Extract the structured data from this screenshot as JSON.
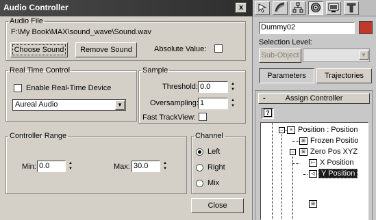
{
  "window": {
    "title": "Audio Controller",
    "close_glyph": "x"
  },
  "audio_file": {
    "legend": "Audio File",
    "path": "F:\\My Book\\MAX\\sound_wave\\Sound.wav",
    "choose_label": "Choose Sound",
    "remove_label": "Remove Sound",
    "absolute_label": "Absolute Value:"
  },
  "realtime": {
    "legend": "Real Time Control",
    "enable_label": "Enable Real-Time Device",
    "device_value": "Aureal Audio"
  },
  "sample": {
    "legend": "Sample",
    "threshold_label": "Threshold:",
    "threshold_value": "0.0",
    "oversampling_label": "Oversampling:",
    "oversampling_value": "1",
    "fast_label": "Fast TrackView:"
  },
  "range": {
    "legend": "Controller Range",
    "min_label": "Min:",
    "min_value": "0.0",
    "max_label": "Max:",
    "max_value": "30.0"
  },
  "channel": {
    "legend": "Channel",
    "left": "Left",
    "right": "Right",
    "mix": "Mix",
    "selected": "Left"
  },
  "close_label": "Close",
  "panel": {
    "tabs": [
      "create-icon",
      "modify-icon",
      "hierarchy-icon",
      "motion-icon",
      "display-icon",
      "utilities-icon"
    ],
    "object_name": "Dummy02",
    "object_color": "#c0392b",
    "selection_level_label": "Selection Level:",
    "subobject_label": "Sub-Object",
    "parameters_label": "Parameters",
    "trajectories_label": "Trajectories",
    "rollout_toggle": "-",
    "rollout_title": "Assign Controller",
    "help_glyph": "?",
    "tree": [
      {
        "label": "Position : Position"
      },
      {
        "label": "Frozen Positio"
      },
      {
        "label": "Zero Pos XYZ"
      },
      {
        "label": "X Position"
      },
      {
        "label": "Y Position"
      }
    ]
  }
}
